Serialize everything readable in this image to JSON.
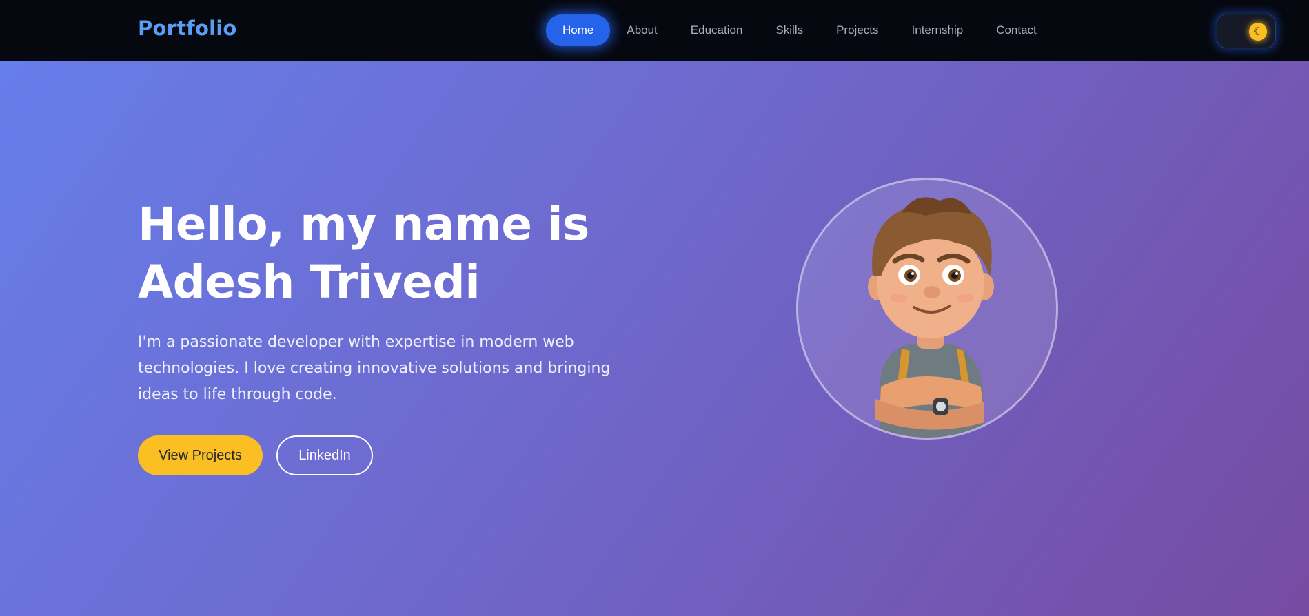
{
  "brand": {
    "name": "Portfolio",
    "color": "#5b9cf5"
  },
  "nav": {
    "items": [
      {
        "label": "Home",
        "active": true
      },
      {
        "label": "About",
        "active": false
      },
      {
        "label": "Education",
        "active": false
      },
      {
        "label": "Skills",
        "active": false
      },
      {
        "label": "Projects",
        "active": false
      },
      {
        "label": "Internship",
        "active": false
      },
      {
        "label": "Contact",
        "active": false
      }
    ],
    "active_color": "#2563eb"
  },
  "theme_toggle": {
    "icon": "moon-icon",
    "glyph": "☾",
    "state": "dark"
  },
  "hero": {
    "title_line1": "Hello, my name is",
    "title_line2": "Adesh Trivedi",
    "description": "I'm a passionate developer with expertise in modern web technologies. I love creating innovative solutions and bringing ideas to life through code.",
    "primary_button": "View Projects",
    "secondary_button": "LinkedIn",
    "avatar": "cartoon-boy-avatar",
    "accent_color": "#fbbf24",
    "gradient": [
      "#667eea",
      "#764ba2"
    ]
  }
}
